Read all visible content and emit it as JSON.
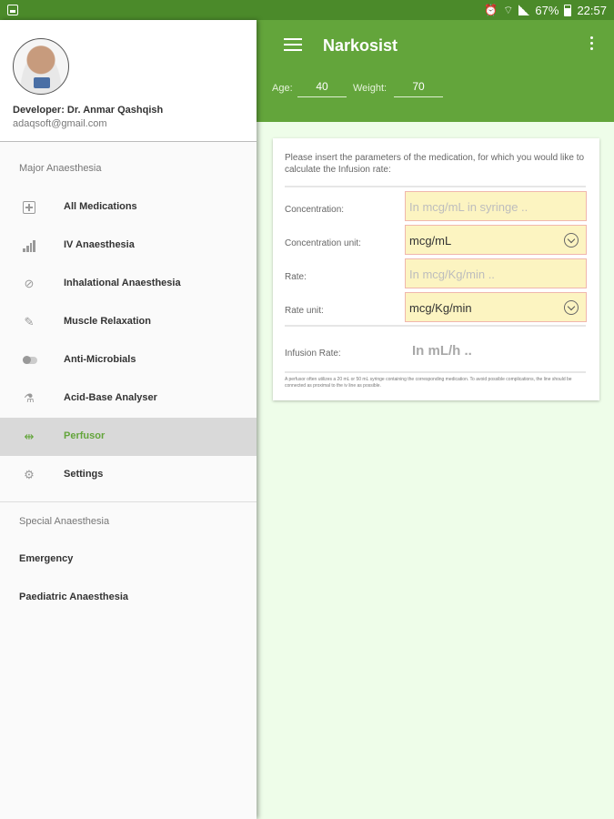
{
  "status_bar": {
    "battery": "67%",
    "time": "22:57"
  },
  "app": {
    "title": "Narkosist",
    "age_label": "Age:",
    "age_value": "40",
    "weight_label": "Weight:",
    "weight_value": "70"
  },
  "card": {
    "intro": "Please insert the parameters of the medication, for which you would like to calculate the Infusion rate:",
    "rows": [
      {
        "label": "Concentration:",
        "value": "In mcg/mL in syringe ..",
        "kind": "input"
      },
      {
        "label": "Concentration unit:",
        "value": "mcg/mL",
        "kind": "select"
      },
      {
        "label": "Rate:",
        "value": "In mcg/Kg/min ..",
        "kind": "input"
      },
      {
        "label": "Rate unit:",
        "value": "mcg/Kg/min",
        "kind": "select"
      }
    ],
    "result_label": "Infusion Rate:",
    "result_value": "In mL/h ..",
    "footnote": "A perfusor often utilizes a 20 mL or 50 mL syringe containing the corresponding medication. To avoid possible complications, the line should be connected as proximal to the iv line as possible."
  },
  "drawer": {
    "developer": "Developer: Dr. Anmar Qashqish",
    "email": "adaqsoft@gmail.com",
    "section1": "Major Anaesthesia",
    "items": [
      {
        "label": "All Medications",
        "icon": "plus-box-icon"
      },
      {
        "label": "IV Anaesthesia",
        "icon": "bars-icon"
      },
      {
        "label": "Inhalational Anaesthesia",
        "icon": "pill-icon"
      },
      {
        "label": "Muscle Relaxation",
        "icon": "syringe-icon"
      },
      {
        "label": "Anti-Microbials",
        "icon": "toggle-icon"
      },
      {
        "label": "Acid-Base Analyser",
        "icon": "flask-icon"
      },
      {
        "label": "Perfusor",
        "icon": "perfusor-icon"
      },
      {
        "label": "Settings",
        "icon": "gear-icon"
      }
    ],
    "section2": "Special Anaesthesia",
    "extra_items": [
      {
        "label": "Emergency"
      },
      {
        "label": "Paediatric Anaesthesia"
      }
    ]
  },
  "colors": {
    "primary": "#63a53b",
    "status": "#4b8a2a",
    "background": "#eefde9",
    "field": "#fcf4c1",
    "field_border": "#f0b7ad"
  }
}
